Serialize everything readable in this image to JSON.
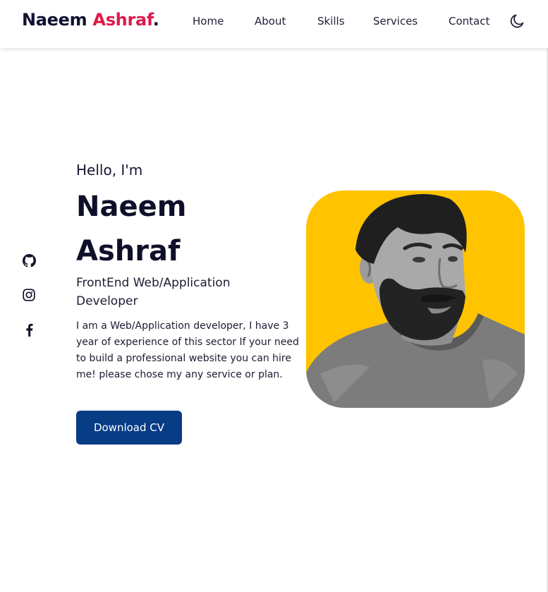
{
  "header": {
    "logo": {
      "first": "Naeem",
      "last": "Ashraf",
      "dot": "."
    },
    "nav": [
      "Home",
      "About",
      "Skills",
      "Services",
      "Contact"
    ],
    "theme_toggle_icon": "moon-icon"
  },
  "social": {
    "icons": [
      "github-icon",
      "instagram-icon",
      "facebook-icon"
    ]
  },
  "hero": {
    "greeting": "Hello, I'm",
    "name": "Naeem Ashraf",
    "role": "FrontEnd Web/Application Developer",
    "bio": "I am a Web/Application developer, I have 3 year of experience of this sector If your need to build a professional website you can hire me! please chose my any service or plan.",
    "cv_button": "Download CV"
  },
  "colors": {
    "accent": "#dc1b4b",
    "button": "#083c85",
    "photo_background": "#ffc300",
    "text_dark": "#0f0f2a"
  }
}
